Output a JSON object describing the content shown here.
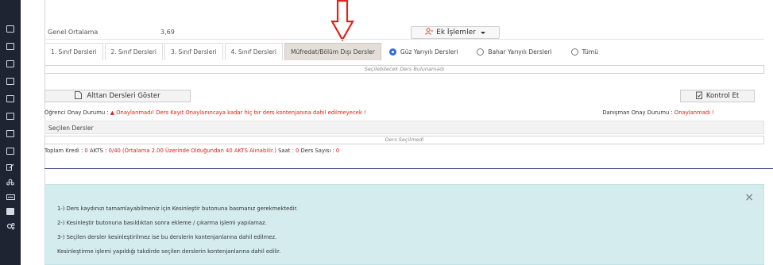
{
  "sidebar": {
    "icons": [
      "square-icon",
      "square-icon",
      "square-icon",
      "square-icon",
      "square-icon",
      "square-icon",
      "square-icon",
      "square-icon",
      "edit-icon",
      "users-icon",
      "id-card-icon",
      "badge-icon",
      "settings-icon"
    ]
  },
  "header": {
    "gpa_label": "Genel Ortalama",
    "gpa_value": "3,69",
    "extra_actions_label": "Ek İşlemler"
  },
  "tabs": [
    {
      "label": "1. Sınıf Dersleri"
    },
    {
      "label": "2. Sınıf Dersleri"
    },
    {
      "label": "3. Sınıf Dersleri"
    },
    {
      "label": "4. Sınıf Dersleri"
    },
    {
      "label": "Müfredat/Bölüm Dışı Dersler"
    }
  ],
  "active_tab": "Müfredat/Bölüm Dışı Dersler",
  "semester_filter": {
    "options": [
      {
        "label": "Güz Yarıyılı Dersleri",
        "checked": true
      },
      {
        "label": "Bahar Yarıyılı Dersleri",
        "checked": false
      },
      {
        "label": "Tümü",
        "checked": false
      }
    ]
  },
  "course_list_empty": "Seçilebilecek Ders Bulunamadı",
  "buttons": {
    "alttan": "Alttan Dersleri Göster",
    "kontrol": "Kontrol Et"
  },
  "status": {
    "student_label": "Öğrenci Onay Durumu :",
    "student_warning": "Onaylanmadı! Ders Kayıt Onaylanıncaya kadar hiç bir ders kontenjanına dahil edilmeyecek !",
    "advisor_label": "Danışman Onay Durumu :",
    "advisor_value": "Onaylanmadı !"
  },
  "selected": {
    "header": "Seçilen Dersler",
    "empty": "Ders Seçilmedi"
  },
  "totals": {
    "kredi_label": "Toplam Kredi :",
    "kredi_value": "0",
    "akts_label": "AKTS :",
    "akts_value": "0/40 (Ortalama 2.00 Üzerinde Olduğundan 40 AKTS Alınabilir.)",
    "saat_label": "Saat :",
    "saat_value": "0",
    "ders_sayisi_label": "Ders Sayısı :",
    "ders_sayisi_value": "0"
  },
  "info": {
    "lines": [
      "1-) Ders kaydınızı tamamlayabilmeniz için Kesinleştir butonuna basmanız gerekmektedir.",
      "2-) Kesinleştir butonuna basıldıktan sonra ekleme / çıkarma işlemi yapılamaz.",
      "3-) Seçilen dersler kesinleştirilmez ise bu derslerin kontenjanlarına dahil edilmez.",
      "Kesinleştirme işlemi yapıldığı takdirde seçilen derslerin kontenjanlarına dahil edilir."
    ]
  },
  "colors": {
    "sidebar_bg": "#1e2432",
    "active_tab_bg": "#e3ded8",
    "warning_red": "#d9201a",
    "info_bg": "#d5ecef",
    "radio_blue": "#2e6fd8",
    "annotation_arrow": "#e0231b"
  }
}
